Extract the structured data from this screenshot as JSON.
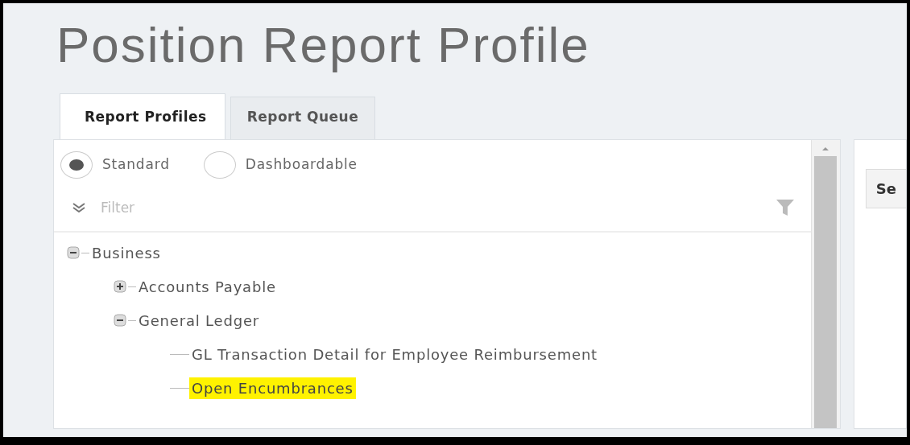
{
  "page_title": "Position Report Profile",
  "tabs": [
    {
      "label": "Report Profiles",
      "selected": true
    },
    {
      "label": "Report Queue",
      "selected": false
    }
  ],
  "view_options": [
    {
      "label": "Standard",
      "selected": true
    },
    {
      "label": "Dashboardable",
      "selected": false
    }
  ],
  "filter": {
    "placeholder": "Filter"
  },
  "tree": [
    {
      "label": "Business",
      "expanded": true,
      "selected": false,
      "children": [
        {
          "label": "Accounts Payable",
          "expanded": false,
          "selected": false
        },
        {
          "label": "General Ledger",
          "expanded": true,
          "selected": false,
          "children": [
            {
              "label": "GL Transaction Detail for Employee Reimbursement",
              "selected": false
            },
            {
              "label": "Open Encumbrances",
              "selected": true
            }
          ]
        }
      ]
    }
  ],
  "right_panel": {
    "button": "Se"
  }
}
